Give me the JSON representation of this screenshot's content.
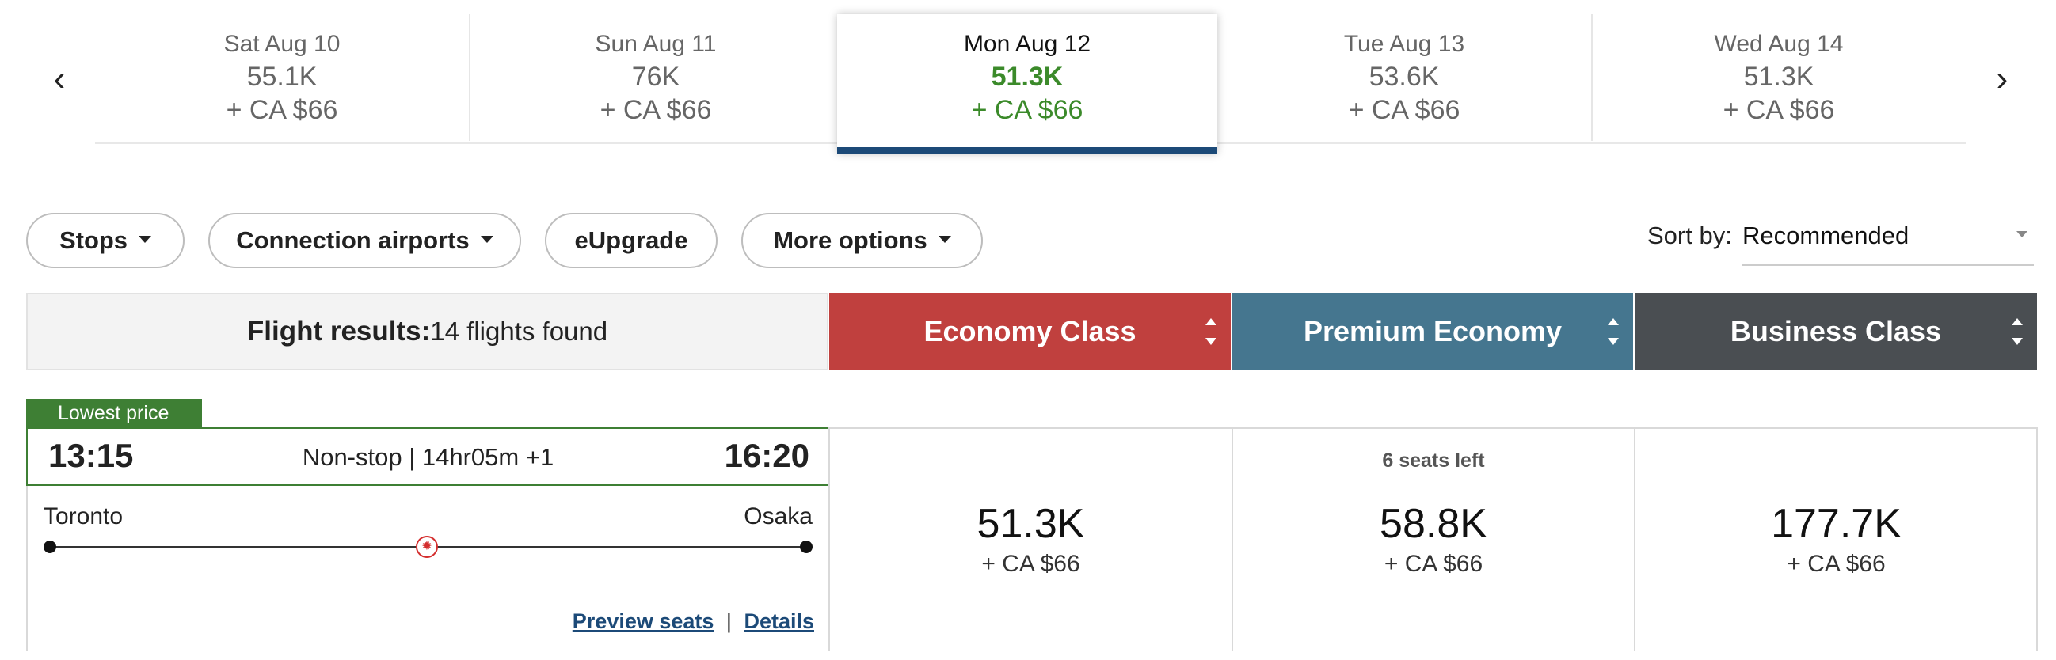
{
  "dates": [
    {
      "day": "Sat Aug 10",
      "points": "55.1K",
      "fee": "+ CA $66"
    },
    {
      "day": "Sun Aug 11",
      "points": "76K",
      "fee": "+ CA $66"
    },
    {
      "day": "Mon Aug 12",
      "points": "51.3K",
      "fee": "+ CA $66"
    },
    {
      "day": "Tue Aug 13",
      "points": "53.6K",
      "fee": "+ CA $66"
    },
    {
      "day": "Wed Aug 14",
      "points": "51.3K",
      "fee": "+ CA $66"
    }
  ],
  "nav": {
    "prev": "‹",
    "next": "›"
  },
  "filters": {
    "stops": "Stops",
    "connection": "Connection airports",
    "eupgrade": "eUpgrade",
    "more": "More options"
  },
  "sort": {
    "label": "Sort by:",
    "value": "Recommended"
  },
  "results": {
    "label": "Flight results:",
    "count": "14 flights found"
  },
  "cabins": [
    {
      "name": "Economy Class",
      "color": "#c0403e"
    },
    {
      "name": "Premium Economy",
      "color": "#45768f"
    },
    {
      "name": "Business Class",
      "color": "#4a4e52"
    }
  ],
  "flight": {
    "badge": "Lowest price",
    "depart": "13:15",
    "arrive": "16:20",
    "summary": "Non-stop | 14hr05m +1",
    "origin": "Toronto",
    "destination": "Osaka",
    "preview": "Preview seats",
    "sep": "|",
    "details": "Details",
    "fares": [
      {
        "seats": "",
        "points": "51.3K",
        "fee": "+ CA $66"
      },
      {
        "seats": "6 seats left",
        "points": "58.8K",
        "fee": "+ CA $66"
      },
      {
        "seats": "",
        "points": "177.7K",
        "fee": "+ CA $66"
      }
    ]
  }
}
